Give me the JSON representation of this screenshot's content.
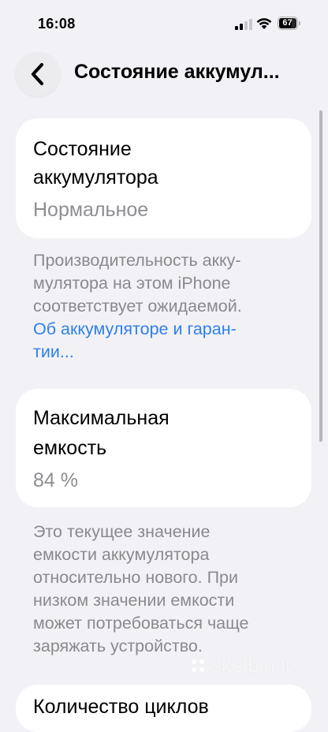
{
  "status_bar": {
    "time": "16:08",
    "battery": "67",
    "icons": [
      "cellular-signal-icon",
      "wifi-icon",
      "battery-icon"
    ]
  },
  "nav": {
    "back_icon": "chevron-left-icon",
    "title": "Состояние аккумул..."
  },
  "battery_health": {
    "title_line1": "Состояние",
    "title_line2": "аккумулятора",
    "value": "Нормальное"
  },
  "health_footnote": {
    "line1": "Производительность акку-",
    "line2": "мулятора на этом iPhone",
    "line3": "соответствует ожидаемой.",
    "link_line1": "Об аккумуляторе и гаран-",
    "link_line2": "тии..."
  },
  "max_capacity": {
    "title_line1": "Максимальная",
    "title_line2": "емкость",
    "value": "84 %"
  },
  "capacity_footnote": {
    "line1": "Это текущее значение",
    "line2": "емкости аккумулятора",
    "line3": "относительно нового. При",
    "line4": "низком значении емкости",
    "line5": "может потребоваться чаще",
    "line6": "заряжать устройство."
  },
  "next_section": {
    "title": "Количество циклов"
  },
  "watermark": {
    "text": "skelbiu.lt"
  },
  "colors": {
    "background": "#f2f2f6",
    "card": "#ffffff",
    "secondary_text": "#8a8a8e",
    "link": "#2f7fe8"
  }
}
